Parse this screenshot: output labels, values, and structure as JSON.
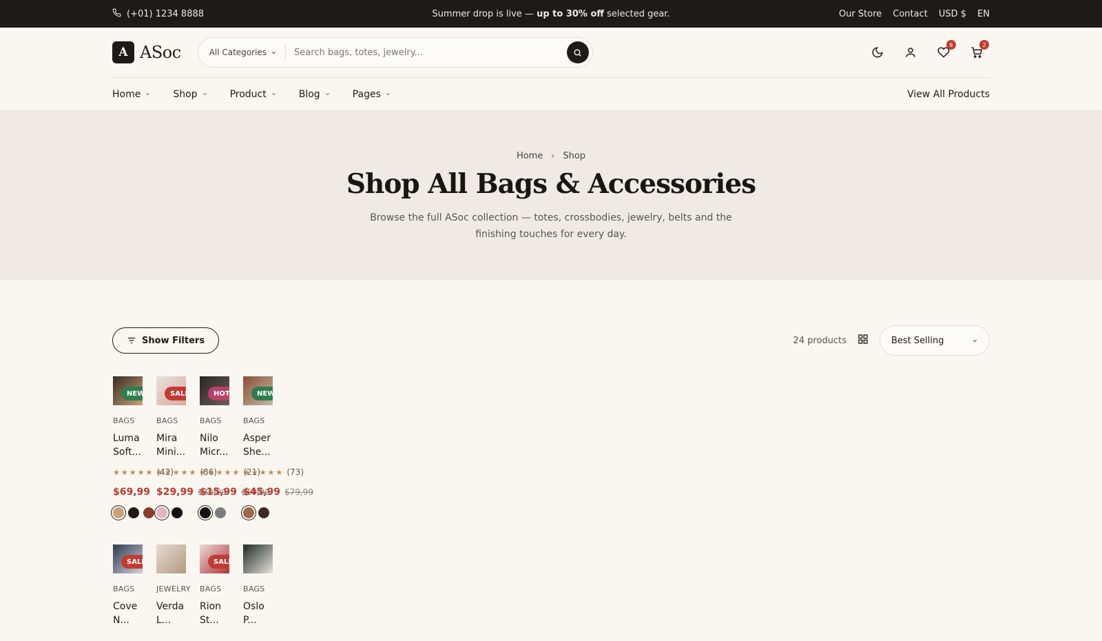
{
  "topbar": {
    "phone": "(+01) 1234 8888",
    "promo_pre": "Summer drop is live — ",
    "promo_bold": "up to 30% off",
    "promo_post": " selected gear.",
    "links": [
      "Our Store",
      "Contact",
      "USD $",
      "EN"
    ]
  },
  "header": {
    "logo_letter": "A",
    "logo_text": "ASoc",
    "search_category": "All Categories",
    "search_placeholder": "Search bags, totes, jewelry...",
    "wishlist_count": "6",
    "cart_count": "2"
  },
  "nav": {
    "items": [
      "Home",
      "Shop",
      "Product",
      "Blog",
      "Pages"
    ],
    "view_all": "View All Products"
  },
  "hero": {
    "crumb_home": "Home",
    "crumb_current": "Shop",
    "title": "Shop All Bags & Accessories",
    "subtitle": "Browse the full ASoc collection — totes, crossbodies, jewelry, belts and the finishing touches for every day."
  },
  "toolbar": {
    "filters_label": "Show Filters",
    "count": "24 products",
    "sort": "Best Selling"
  },
  "products_row1": [
    {
      "badge": "NEW",
      "badge_color": "#2e7d4f",
      "category": "BAGS",
      "name": "Luma Soft...",
      "rating": "(42)",
      "price": "$69,99",
      "was": "",
      "thumb": [
        "#3a2a20",
        "#c7a17a"
      ],
      "swatches": [
        "#c9a27c",
        "#1f1a16",
        "#8a3c2e"
      ]
    },
    {
      "badge": "SALE",
      "badge_color": "#c23b32",
      "category": "BAGS",
      "name": "Mira Mini...",
      "rating": "(86)",
      "price": "$29,99",
      "was": "$39,99",
      "thumb": [
        "#e9e2dc",
        "#d8a9a0"
      ],
      "swatches": [
        "#e2b4c4",
        "#111111"
      ]
    },
    {
      "badge": "HOT",
      "badge_color": "#b8406a",
      "category": "BAGS",
      "name": "Nilo Micr...",
      "rating": "(21)",
      "price": "$15,99",
      "was": "$19,99",
      "thumb": [
        "#2b2522",
        "#6b5f59"
      ],
      "swatches": [
        "#111111",
        "#7c7c80"
      ]
    },
    {
      "badge": "NEW",
      "badge_color": "#2e7d4f",
      "category": "BAGS",
      "name": "Asper She...",
      "rating": "(73)",
      "price": "$45,99",
      "was": "$79,99",
      "thumb": [
        "#8a5036",
        "#c8b8a8"
      ],
      "swatches": [
        "#a0694a",
        "#3a2a24"
      ]
    }
  ],
  "products_row2": [
    {
      "badge": "SALE",
      "badge_color": "#c23b32",
      "category": "BAGS",
      "name": "Cove N...",
      "thumb": [
        "#2d3a52",
        "#d0d4dc"
      ]
    },
    {
      "badge": "",
      "badge_color": "",
      "category": "JEWELRY",
      "name": "Verda L...",
      "thumb": [
        "#e4dcd2",
        "#b49a80"
      ]
    },
    {
      "badge": "SALE",
      "badge_color": "#c23b32",
      "category": "BAGS",
      "name": "Rion St...",
      "thumb": [
        "#e8dcd6",
        "#b0323a"
      ]
    },
    {
      "badge": "",
      "badge_color": "",
      "category": "BAGS",
      "name": "Oslo P...",
      "thumb": [
        "#1f2a24",
        "#e8e4de"
      ]
    }
  ]
}
